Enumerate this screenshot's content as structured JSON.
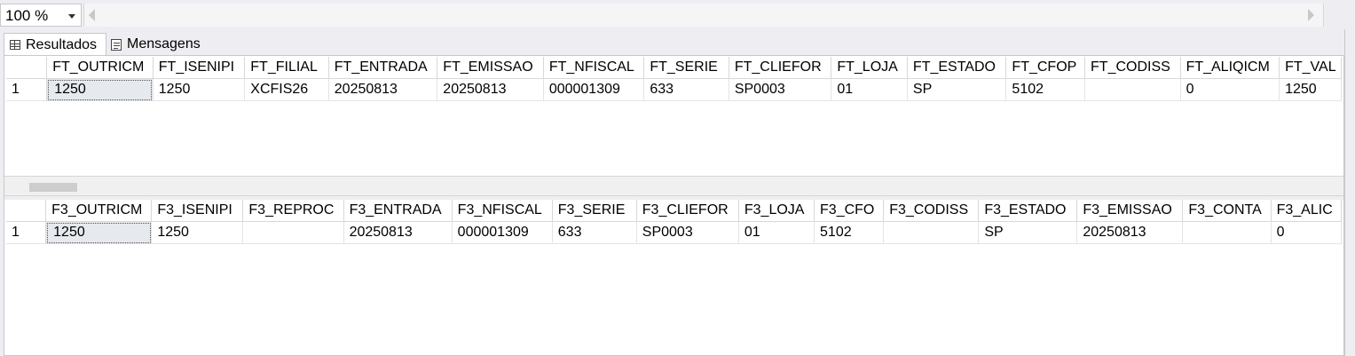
{
  "toolbar": {
    "zoom_value": "100 %"
  },
  "tabs": {
    "results_label": "Resultados",
    "messages_label": "Mensagens"
  },
  "grid1": {
    "columns": [
      "FT_OUTRICM",
      "FT_ISENIPI",
      "FT_FILIAL",
      "FT_ENTRADA",
      "FT_EMISSAO",
      "FT_NFISCAL",
      "FT_SERIE",
      "FT_CLIEFOR",
      "FT_LOJA",
      "FT_ESTADO",
      "FT_CFOP",
      "FT_CODISS",
      "FT_ALIQICM",
      "FT_VAL"
    ],
    "rows": [
      {
        "rownum": "1",
        "cells": [
          "1250",
          "1250",
          "XCFIS26",
          "20250813",
          "20250813",
          "000001309",
          "633",
          "SP0003",
          "01",
          "SP",
          "5102",
          "",
          "0",
          "1250"
        ]
      }
    ]
  },
  "grid2": {
    "columns": [
      "F3_OUTRICM",
      "F3_ISENIPI",
      "F3_REPROC",
      "F3_ENTRADA",
      "F3_NFISCAL",
      "F3_SERIE",
      "F3_CLIEFOR",
      "F3_LOJA",
      "F3_CFO",
      "F3_CODISS",
      "F3_ESTADO",
      "F3_EMISSAO",
      "F3_CONTA",
      "F3_ALIC"
    ],
    "rows": [
      {
        "rownum": "1",
        "cells": [
          "1250",
          "1250",
          "",
          "20250813",
          "000001309",
          "633",
          "SP0003",
          "01",
          "5102",
          "",
          "SP",
          "20250813",
          "",
          "0"
        ]
      }
    ]
  }
}
